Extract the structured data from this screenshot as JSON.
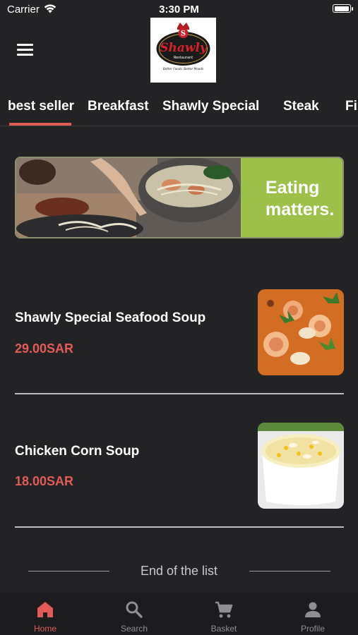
{
  "status_bar": {
    "carrier": "Carrier",
    "time": "3:30 PM",
    "battery_level": 1.0
  },
  "header": {
    "logo": {
      "name_text": "Shawly",
      "subtitle": "Restaurant",
      "tagline": "Better Foods, Better Moods",
      "letter": "S"
    }
  },
  "tabs": [
    "best seller",
    "Breakfast",
    "Shawly Special",
    "Steak",
    "Fi"
  ],
  "active_tab": "best seller",
  "banner": {
    "line1": "Eating",
    "line2": "matters."
  },
  "products": [
    {
      "name": "Shawly Special Seafood Soup",
      "price": "29.00SAR"
    },
    {
      "name": "Chicken Corn Soup",
      "price": "18.00SAR"
    }
  ],
  "end_of_list": "End of the list",
  "bottom_nav": [
    {
      "label": "Home",
      "icon": "home-icon",
      "active": true
    },
    {
      "label": "Search",
      "icon": "search-icon",
      "active": false
    },
    {
      "label": "Basket",
      "icon": "cart-icon",
      "active": false
    },
    {
      "label": "Profile",
      "icon": "profile-icon",
      "active": false
    }
  ],
  "colors": {
    "accent": "#e25b58",
    "background": "#232325",
    "banner_green": "#9cc04a",
    "nav_background": "#1c1c1e"
  }
}
